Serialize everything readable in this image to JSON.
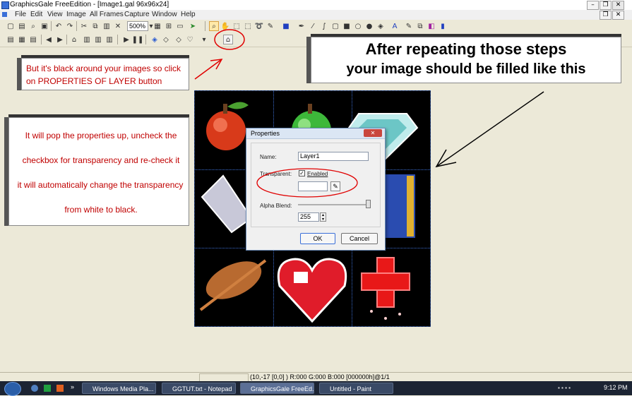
{
  "window": {
    "title": "GraphicsGale FreeEdition - [Image1.gal 96x96x24]"
  },
  "menu": [
    "File",
    "Edit",
    "View",
    "Image",
    "All Frames",
    "Capture",
    "Window",
    "Help"
  ],
  "toolbar": {
    "zoom": "500%"
  },
  "callouts": {
    "properties_hint": "But it's black around your images so click on PROPERTIES OF LAYER button",
    "transparency_hint_lines": [
      "It will pop the properties up, uncheck the",
      "checkbox for transparency and re-check it",
      "it will automatically change the transparency",
      "from white to black."
    ],
    "result_lines": [
      "After repeating those steps",
      "your image should be filled like this"
    ]
  },
  "dialog": {
    "title": "Properties",
    "name_label": "Name:",
    "name_value": "Layer1",
    "transparent_label": "Transparent:",
    "enabled_label": "Enabled",
    "alpha_label": "Alpha Blend:",
    "alpha_value": "255",
    "ok": "OK",
    "cancel": "Cancel"
  },
  "status": {
    "coords": "(10,-17 [0,0] ) R:000 G:000 B:000  [000000h]@1/1"
  },
  "taskbar": {
    "items": [
      "Windows Media Pla...",
      "GGTUT.txt - Notepad",
      "GraphicsGale FreeEd...",
      "Untitled - Paint"
    ],
    "clock": "9:12 PM"
  },
  "colors": {
    "callout_text": "#c00000",
    "grid": "#3b6dd1",
    "annotation": "#e00000"
  }
}
